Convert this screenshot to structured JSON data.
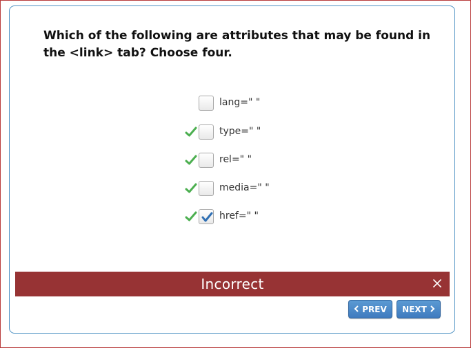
{
  "question": "Which of the following are attributes that may be found in the <link> tab? Choose four.",
  "options": [
    {
      "label": "lang=\" \"",
      "correct_mark": false,
      "checked": false
    },
    {
      "label": "type=\" \"",
      "correct_mark": true,
      "checked": false
    },
    {
      "label": "rel=\" \"",
      "correct_mark": true,
      "checked": false
    },
    {
      "label": "media=\" \"",
      "correct_mark": true,
      "checked": false
    },
    {
      "label": "href=\" \"",
      "correct_mark": true,
      "checked": true
    }
  ],
  "feedback": {
    "text": "Incorrect"
  },
  "nav": {
    "prev_label": "PREV",
    "next_label": "NEXT"
  },
  "colors": {
    "feedback_bg": "#973334",
    "button_blue": "#4a8ac9",
    "correct_green": "#4caf50",
    "check_blue": "#2f6fb3",
    "card_border": "#4a8fc2"
  }
}
